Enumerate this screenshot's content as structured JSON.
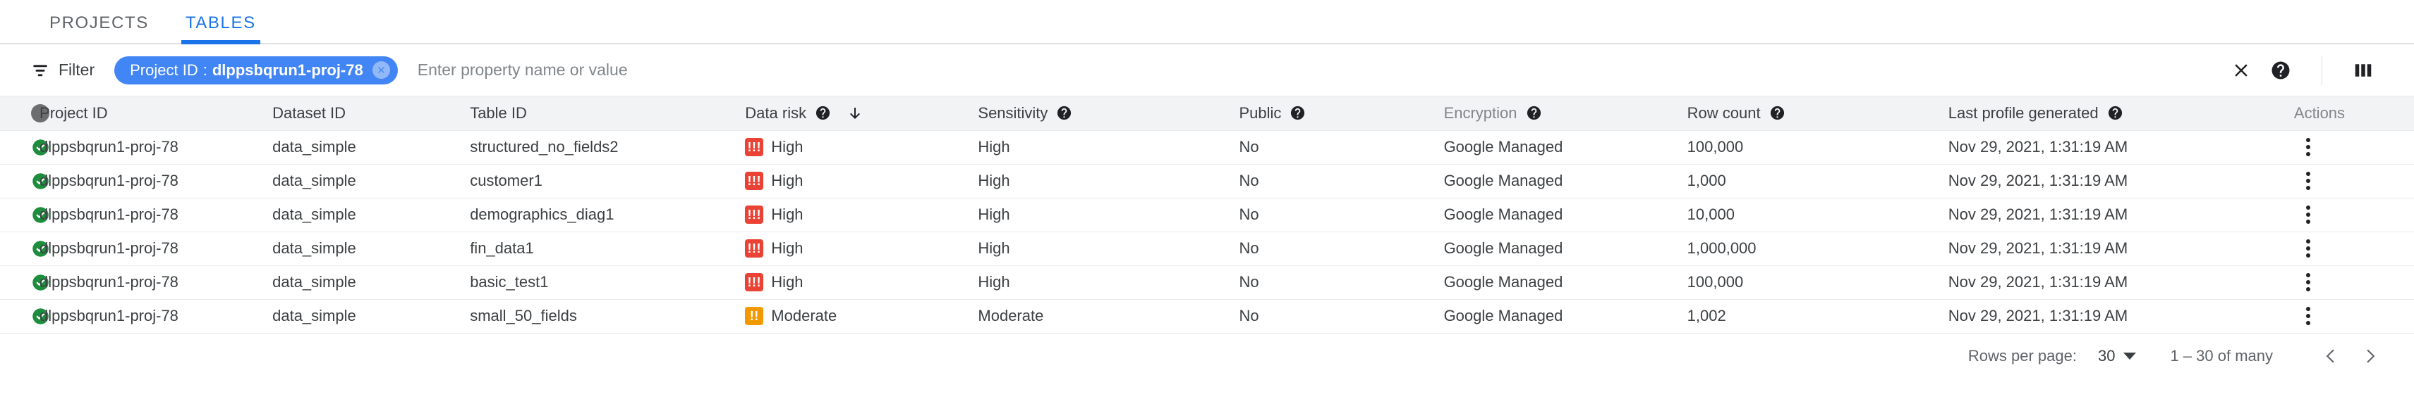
{
  "tabs": [
    {
      "label": "PROJECTS",
      "active": false
    },
    {
      "label": "TABLES",
      "active": true
    }
  ],
  "filter": {
    "button_label": "Filter",
    "filter_icon": "filter-list-icon",
    "chip": {
      "key": "Project ID",
      "separator": ":",
      "value": "dlppsbqrun1-proj-78",
      "remove_icon": "close-circle-icon"
    },
    "input_value": "",
    "placeholder": "Enter property name or value",
    "actions": [
      {
        "name": "clear-filter-button",
        "icon": "close-icon"
      },
      {
        "name": "help-button",
        "icon": "help-icon"
      },
      {
        "name": "column-display-button",
        "icon": "column-display-icon"
      }
    ]
  },
  "table": {
    "columns": [
      {
        "id": "status",
        "label": "",
        "help": false,
        "muted": false,
        "sort": null
      },
      {
        "id": "project",
        "label": "Project ID",
        "help": false,
        "muted": false,
        "sort": null
      },
      {
        "id": "dataset",
        "label": "Dataset ID",
        "help": false,
        "muted": false,
        "sort": null
      },
      {
        "id": "table",
        "label": "Table ID",
        "help": false,
        "muted": false,
        "sort": null
      },
      {
        "id": "risk",
        "label": "Data risk",
        "help": true,
        "muted": false,
        "sort": "desc"
      },
      {
        "id": "sens",
        "label": "Sensitivity",
        "help": true,
        "muted": false,
        "sort": null
      },
      {
        "id": "public",
        "label": "Public",
        "help": true,
        "muted": false,
        "sort": null
      },
      {
        "id": "enc",
        "label": "Encryption",
        "help": true,
        "muted": true,
        "sort": null
      },
      {
        "id": "rows",
        "label": "Row count",
        "help": true,
        "muted": false,
        "sort": null
      },
      {
        "id": "date",
        "label": "Last profile generated",
        "help": true,
        "muted": false,
        "sort": null
      },
      {
        "id": "actions",
        "label": "Actions",
        "help": false,
        "muted": true,
        "sort": null
      }
    ],
    "rows": [
      {
        "status": "ok",
        "project": "dlppsbqrun1-proj-78",
        "dataset": "data_simple",
        "table": "structured_no_fields2",
        "risk": "High",
        "risk_level": "high",
        "sensitivity": "High",
        "public": "No",
        "encryption": "Google Managed",
        "row_count": "100,000",
        "last_profile": "Nov 29, 2021, 1:31:19 AM"
      },
      {
        "status": "ok",
        "project": "dlppsbqrun1-proj-78",
        "dataset": "data_simple",
        "table": "customer1",
        "risk": "High",
        "risk_level": "high",
        "sensitivity": "High",
        "public": "No",
        "encryption": "Google Managed",
        "row_count": "1,000",
        "last_profile": "Nov 29, 2021, 1:31:19 AM"
      },
      {
        "status": "ok",
        "project": "dlppsbqrun1-proj-78",
        "dataset": "data_simple",
        "table": "demographics_diag1",
        "risk": "High",
        "risk_level": "high",
        "sensitivity": "High",
        "public": "No",
        "encryption": "Google Managed",
        "row_count": "10,000",
        "last_profile": "Nov 29, 2021, 1:31:19 AM"
      },
      {
        "status": "ok",
        "project": "dlppsbqrun1-proj-78",
        "dataset": "data_simple",
        "table": "fin_data1",
        "risk": "High",
        "risk_level": "high",
        "sensitivity": "High",
        "public": "No",
        "encryption": "Google Managed",
        "row_count": "1,000,000",
        "last_profile": "Nov 29, 2021, 1:31:19 AM"
      },
      {
        "status": "ok",
        "project": "dlppsbqrun1-proj-78",
        "dataset": "data_simple",
        "table": "basic_test1",
        "risk": "High",
        "risk_level": "high",
        "sensitivity": "High",
        "public": "No",
        "encryption": "Google Managed",
        "row_count": "100,000",
        "last_profile": "Nov 29, 2021, 1:31:19 AM"
      },
      {
        "status": "ok",
        "project": "dlppsbqrun1-proj-78",
        "dataset": "data_simple",
        "table": "small_50_fields",
        "risk": "Moderate",
        "risk_level": "moderate",
        "sensitivity": "Moderate",
        "public": "No",
        "encryption": "Google Managed",
        "row_count": "1,002",
        "last_profile": "Nov 29, 2021, 1:31:19 AM"
      }
    ]
  },
  "pagination": {
    "rows_per_page_label": "Rows per page:",
    "rows_per_page_value": "30",
    "range_label": "1 – 30 of many",
    "prev_icon": "chevron-left-icon",
    "next_icon": "chevron-right-icon"
  },
  "colors": {
    "accent": "#1a73e8",
    "chip": "#4285f4",
    "high": "#ea4335",
    "moderate": "#f29900",
    "ok": "#1e8e3e",
    "header_bg": "#f1f3f4"
  }
}
